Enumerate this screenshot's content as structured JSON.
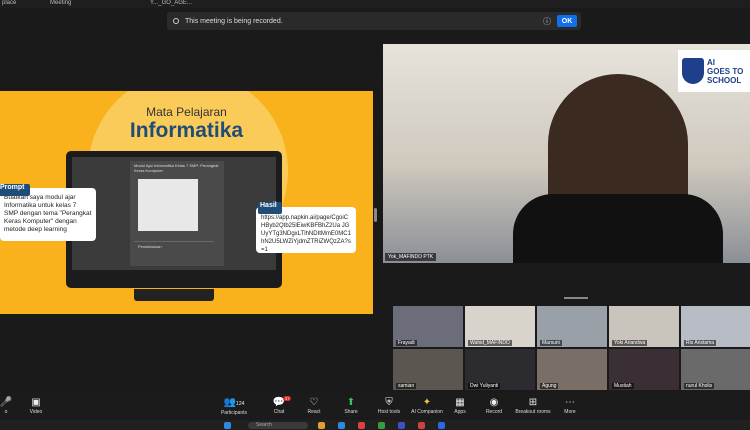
{
  "titlebar": {
    "left": "place",
    "meeting": "Meeting",
    "center": "Y..._GO_AGE..."
  },
  "banner": {
    "text": "This meeting is being recorded.",
    "ok": "OK",
    "info_icon": "info-icon"
  },
  "slide": {
    "subtitle": "Mata Pelajaran",
    "title": "Informatika",
    "doc_title": "Modul Ajar Informatika Kelas 7 SMP: Perangkat Keras Komputer",
    "doc_section": "Pendahuluan",
    "prompt_label": "Prompt",
    "prompt_text": "Buatkan saya modul ajar Informatika untuk kelas 7 SMP dengan tema \"Perangkat Keras Komputer\" dengan metode deep learning",
    "hasil_label": "Hasil",
    "hasil_text": "https://app.napkin.ai/page/CgoiCHByb2Qtb25lEiwKBFBhZ2Ua JGUyYTg3NDgxLTlhNDItMmE0MC1 hN2U5LWZiYjdmZTRiZWQzZA?s=1"
  },
  "speaker": {
    "name": "Yok_MAFINDO PTK",
    "logo_line1": "AI",
    "logo_line2": "GOES TO",
    "logo_line3": "SCHOOL"
  },
  "participants": [
    {
      "name": "Frayadi",
      "color": "#6b6e7a"
    },
    {
      "name": "Wahid_MAFINDO",
      "color": "#d8d4cc"
    },
    {
      "name": "Marsuni",
      "color": "#9aa0a8"
    },
    {
      "name": "Yoki Ariandwa",
      "color": "#c9c4bc"
    },
    {
      "name": "Ris Aristama",
      "color": "#b8bcc4"
    },
    {
      "name": "samian",
      "color": "#5b5650"
    },
    {
      "name": "Dwi Yuliyanti",
      "color": "#2c2c30"
    },
    {
      "name": "Agung",
      "color": "#7a6f66"
    },
    {
      "name": "Mustiah",
      "color": "#3a2f34"
    },
    {
      "name": "nurul Kholis",
      "color": "#6a6a6a"
    }
  ],
  "toolbar": {
    "audio": "o",
    "video": "Video",
    "participants": "Participants",
    "participants_count": "124",
    "chat": "Chat",
    "chat_badge": "37",
    "react": "React",
    "share": "Share",
    "host_tools": "Host tools",
    "ai": "AI Companion",
    "apps": "Apps",
    "record": "Record",
    "breakout": "Breakout rooms",
    "more": "More"
  },
  "taskbar": {
    "search": "Search"
  }
}
